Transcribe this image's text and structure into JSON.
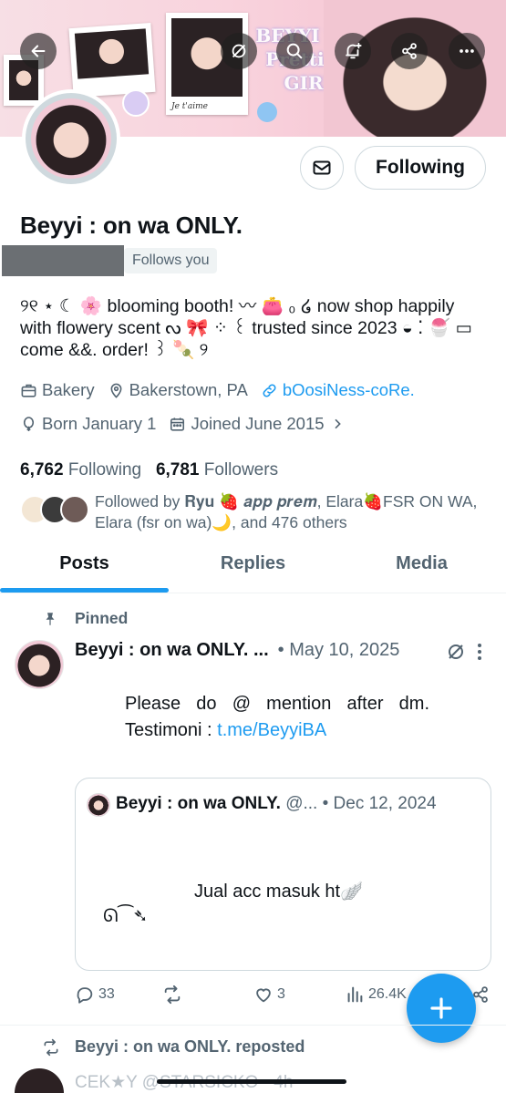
{
  "banner": {
    "decor_text": "BEYYI The Prettiest GIRL",
    "polaroid_caption": "Je t'aime"
  },
  "profile": {
    "display_name": "Beyyi : on wa ONLY.",
    "follows_you": "Follows you",
    "follow_button": "Following",
    "bio": "୨୧ ⋆ ☾ 🌸 blooming booth! 〰 👛 ₀ ໒ now shop happily with flowery scent ᔓ 🎀 ⁘ ꒰ trusted since 2023 ◒ ⁚ 🍧 ▭ come &&. order! ꒱ 🍡 ୨",
    "category": "Bakery",
    "location": "Bakerstown, PA",
    "website": "bOosiNess-coRe.",
    "born": "Born January 1",
    "joined": "Joined June 2015",
    "following_count": "6,762",
    "following_label": "Following",
    "followers_count": "6,781",
    "followers_label": "Followers",
    "followed_by": "Followed by 𝐑𝐲𝐮 🍓 𝒂𝒑𝒑 𝒑𝒓𝒆𝒎, Elara🍓FSR ON WA, Elara (fsr on wa)🌙, and 476 others"
  },
  "tabs": [
    "Posts",
    "Replies",
    "Media"
  ],
  "pinned_post": {
    "pinned_label": "Pinned",
    "author": "Beyyi : on wa ONLY. ...",
    "date": "• May 10, 2025",
    "body_text": "Please do @ mention after dm. Testimoni : ",
    "body_link": "t.me/BeyyiBA",
    "quote": {
      "author": "Beyyi : on wa ONLY.",
      "handle": "@...",
      "date": "• Dec 12, 2024",
      "text": "Jual acc masuk ht🪽",
      "deco": "ᘏ⁀➴"
    },
    "stats": {
      "replies": "33",
      "reposts": "",
      "likes": "3",
      "views": "26.4K"
    }
  },
  "next_post": {
    "repost_label": "Beyyi : on wa ONLY. reposted",
    "preview": "CEK★Y @STARSICKO · 4h"
  },
  "colors": {
    "accent": "#1d9bf0",
    "text": "#0f1419",
    "muted": "#536471",
    "border": "#cfd9de"
  }
}
